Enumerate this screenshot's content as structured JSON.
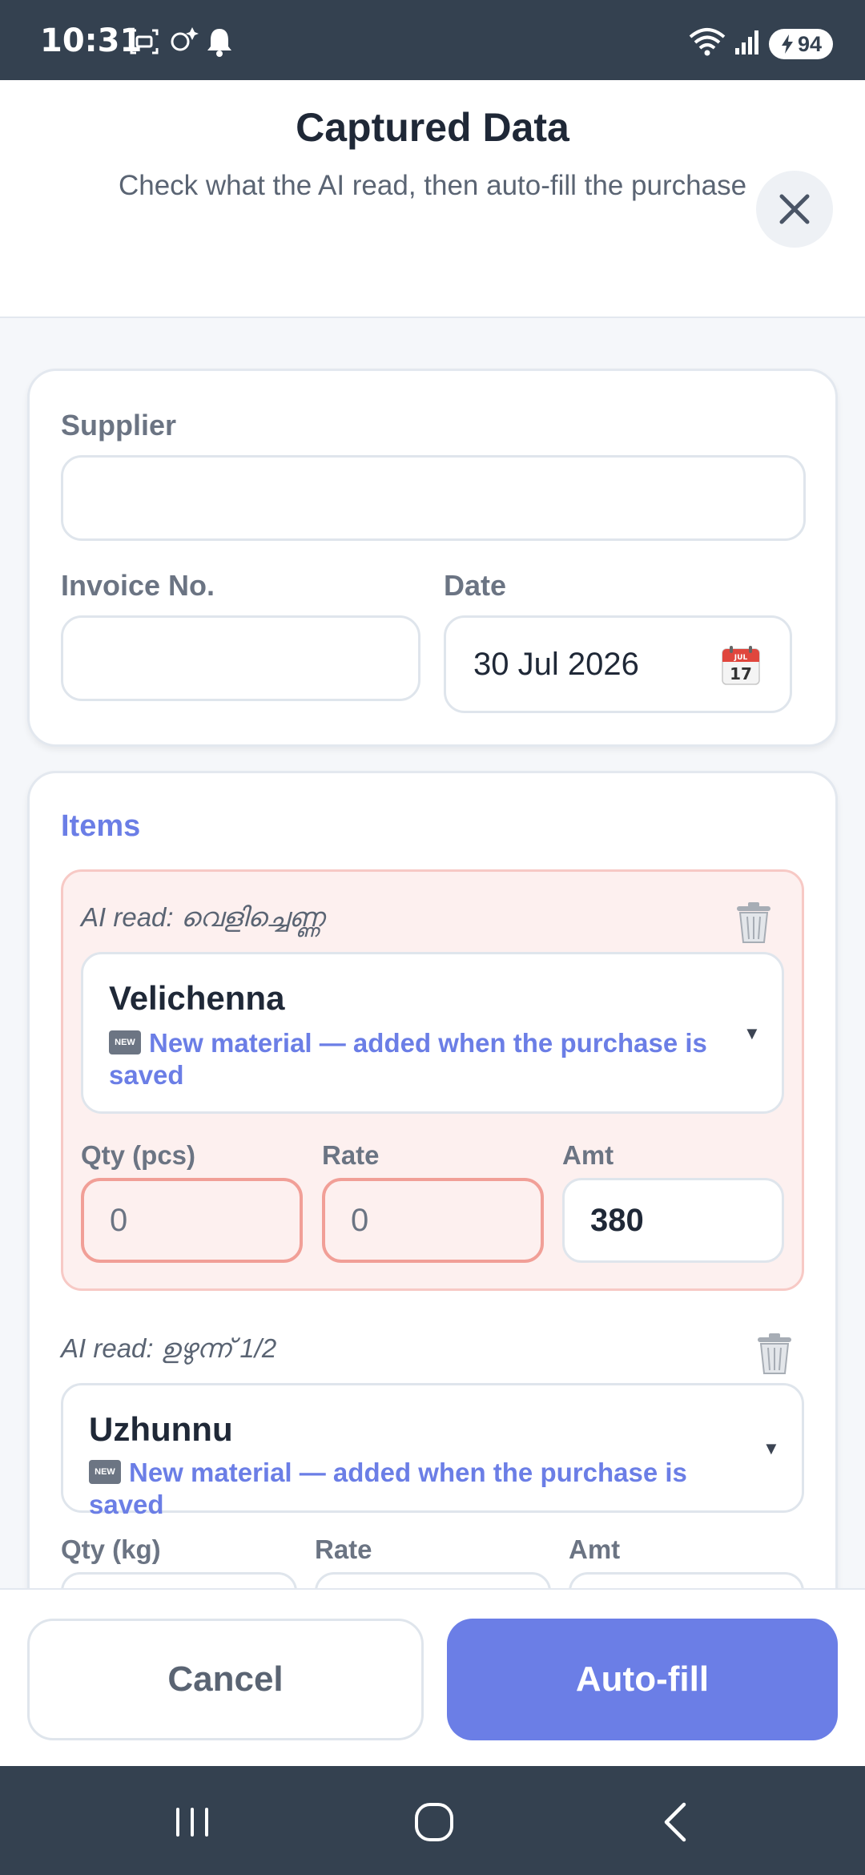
{
  "status": {
    "time": "10:31",
    "battery": "94"
  },
  "header": {
    "title": "Captured Data",
    "subtitle": "Check what the AI read, then auto-fill the purchase"
  },
  "form": {
    "supplier_label": "Supplier",
    "supplier_value": "",
    "invoice_label": "Invoice No.",
    "invoice_value": "",
    "date_label": "Date",
    "date_value": "30 Jul 2026",
    "calendar_month": "JUL",
    "calendar_day": "17"
  },
  "items": {
    "title": "Items",
    "badge_text": "NEW",
    "list": [
      {
        "ai_read": "AI read: വെളിച്ചെണ്ണ",
        "name": "Velichenna",
        "note": "New material — added when the purchase is saved",
        "qty_label": "Qty (pcs)",
        "rate_label": "Rate",
        "amt_label": "Amt",
        "qty": "0",
        "rate": "0",
        "amt": "380"
      },
      {
        "ai_read": "AI read: ഉഴുന്ന് 1/2",
        "name": "Uzhunnu",
        "note": "New material — added when the purchase is saved",
        "qty_label": "Qty (kg)",
        "rate_label": "Rate",
        "amt_label": "Amt"
      }
    ]
  },
  "actions": {
    "cancel": "Cancel",
    "autofill": "Auto-fill"
  },
  "colors": {
    "accent": "#6b7ee6",
    "error_bg": "#fdf0ef",
    "error_border": "#f19f97",
    "bar": "#344150"
  }
}
